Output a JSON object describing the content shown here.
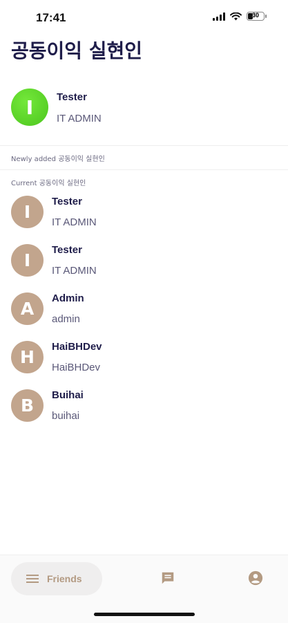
{
  "status": {
    "time": "17:41",
    "battery": "30"
  },
  "page": {
    "title": "공동이익 실현인"
  },
  "new_user": {
    "initial": "I",
    "name": "Tester",
    "role": "IT ADMIN"
  },
  "sections": {
    "newly_added": "Newly added 공동이익 실현인",
    "current": "Current 공동이익 실현인"
  },
  "users": [
    {
      "initial": "I",
      "name": "Tester",
      "role": "IT ADMIN"
    },
    {
      "initial": "I",
      "name": "Tester",
      "role": "IT ADMIN"
    },
    {
      "initial": "A",
      "name": "Admin",
      "role": "admin"
    },
    {
      "initial": "H",
      "name": "HaiBHDev",
      "role": "HaiBHDev"
    },
    {
      "initial": "B",
      "name": "Buihai",
      "role": "buihai"
    }
  ],
  "nav": {
    "friends_label": "Friends",
    "icons": [
      "list-icon",
      "chat-icon",
      "account-icon"
    ]
  },
  "colors": {
    "accent": "#b39a82",
    "avatar_current": "#c2a58d",
    "avatar_new": "#5fd62a",
    "title": "#1f1d4a"
  }
}
